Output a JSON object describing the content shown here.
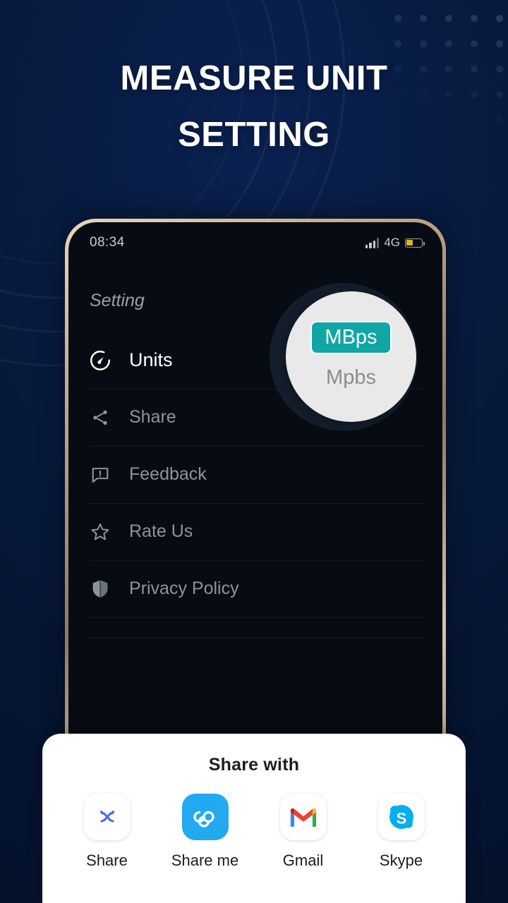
{
  "page": {
    "headline_line1": "MEASURE UNIT",
    "headline_line2": "SETTING",
    "accent_teal": "#0fa6a6",
    "background_navy": "#06183a"
  },
  "phone": {
    "statusbar": {
      "time": "08:34",
      "network": "4G",
      "signal_icon": "signal-bars-icon",
      "battery_icon": "battery-icon",
      "battery_level": "45%"
    },
    "screen_title": "Setting",
    "menu": [
      {
        "label": "Units",
        "icon": "speedometer-icon",
        "active": true
      },
      {
        "label": "Share",
        "icon": "share-nodes-icon",
        "active": false
      },
      {
        "label": "Feedback",
        "icon": "feedback-chat-icon",
        "active": false
      },
      {
        "label": "Rate Us",
        "icon": "star-icon",
        "active": false
      },
      {
        "label": "Privacy Policy",
        "icon": "shield-icon",
        "active": false
      }
    ],
    "unit_popup": {
      "options": [
        {
          "label": "MBps",
          "selected": true
        },
        {
          "label": "Mpbs",
          "selected": false
        }
      ]
    }
  },
  "share_sheet": {
    "title": "Share with",
    "apps": [
      {
        "label": "Share",
        "icon": "share-app-icon"
      },
      {
        "label": "Share me",
        "icon": "shareme-infinity-icon"
      },
      {
        "label": "Gmail",
        "icon": "gmail-icon"
      },
      {
        "label": "Skype",
        "icon": "skype-icon"
      }
    ]
  }
}
